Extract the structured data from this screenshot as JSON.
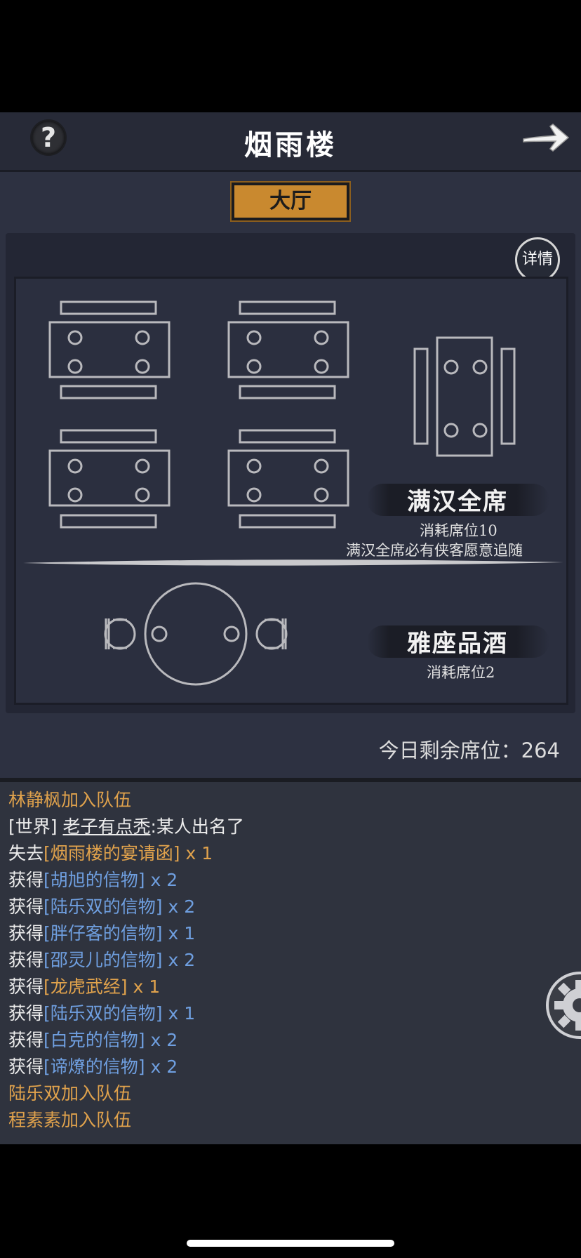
{
  "header": {
    "title": "烟雨楼",
    "help_label": "?"
  },
  "tabs": [
    {
      "label": "大厅",
      "active": true
    }
  ],
  "hall": {
    "detail_label": "详情",
    "banquet": {
      "name": "满汉全席",
      "cost": "消耗席位10",
      "desc": "满汉全席必有侠客愿意追随"
    },
    "drink": {
      "name": "雅座品酒",
      "cost": "消耗席位2"
    },
    "seats_left": "今日剩余席位：264"
  },
  "chat": {
    "lines": [
      {
        "parts": [
          {
            "text": "林静枫加入队伍",
            "color": "orange"
          }
        ]
      },
      {
        "parts": [
          {
            "text": "[世界] ",
            "color": "white"
          },
          {
            "text": "老子有点秃",
            "color": "white",
            "underline": true
          },
          {
            "text": ":某人出名了",
            "color": "white"
          }
        ]
      },
      {
        "parts": [
          {
            "text": "失去",
            "color": "white"
          },
          {
            "text": "[烟雨楼的宴请函]",
            "color": "orange"
          },
          {
            "text": " x 1",
            "color": "orange"
          }
        ]
      },
      {
        "parts": [
          {
            "text": "获得",
            "color": "white"
          },
          {
            "text": "[胡旭的信物]",
            "color": "blue"
          },
          {
            "text": " x 2",
            "color": "blue"
          }
        ]
      },
      {
        "parts": [
          {
            "text": "获得",
            "color": "white"
          },
          {
            "text": "[陆乐双的信物]",
            "color": "blue"
          },
          {
            "text": " x 2",
            "color": "blue"
          }
        ]
      },
      {
        "parts": [
          {
            "text": "获得",
            "color": "white"
          },
          {
            "text": "[胖仔客的信物]",
            "color": "blue"
          },
          {
            "text": " x 1",
            "color": "blue"
          }
        ]
      },
      {
        "parts": [
          {
            "text": "获得",
            "color": "white"
          },
          {
            "text": "[邵灵儿的信物]",
            "color": "blue"
          },
          {
            "text": " x 2",
            "color": "blue"
          }
        ]
      },
      {
        "parts": [
          {
            "text": "获得",
            "color": "white"
          },
          {
            "text": "[龙虎武经]",
            "color": "orange"
          },
          {
            "text": " x 1",
            "color": "orange"
          }
        ]
      },
      {
        "parts": [
          {
            "text": "获得",
            "color": "white"
          },
          {
            "text": "[陆乐双的信物]",
            "color": "blue"
          },
          {
            "text": " x 1",
            "color": "blue"
          }
        ]
      },
      {
        "parts": [
          {
            "text": "获得",
            "color": "white"
          },
          {
            "text": "[白克的信物]",
            "color": "blue"
          },
          {
            "text": " x 2",
            "color": "blue"
          }
        ]
      },
      {
        "parts": [
          {
            "text": "获得",
            "color": "white"
          },
          {
            "text": "[谛燎的信物]",
            "color": "blue"
          },
          {
            "text": " x 2",
            "color": "blue"
          }
        ]
      },
      {
        "parts": [
          {
            "text": "陆乐双加入队伍",
            "color": "orange"
          }
        ]
      },
      {
        "parts": [
          {
            "text": "程素素加入队伍",
            "color": "orange"
          }
        ]
      }
    ]
  },
  "colors": {
    "accent_orange": "#c9892f",
    "chat_orange": "#e0a24c",
    "chat_blue": "#6f9fe0",
    "background": "#2d3141"
  },
  "icons": [
    "help-icon",
    "back-arrow-icon",
    "settings-gear-icon"
  ]
}
